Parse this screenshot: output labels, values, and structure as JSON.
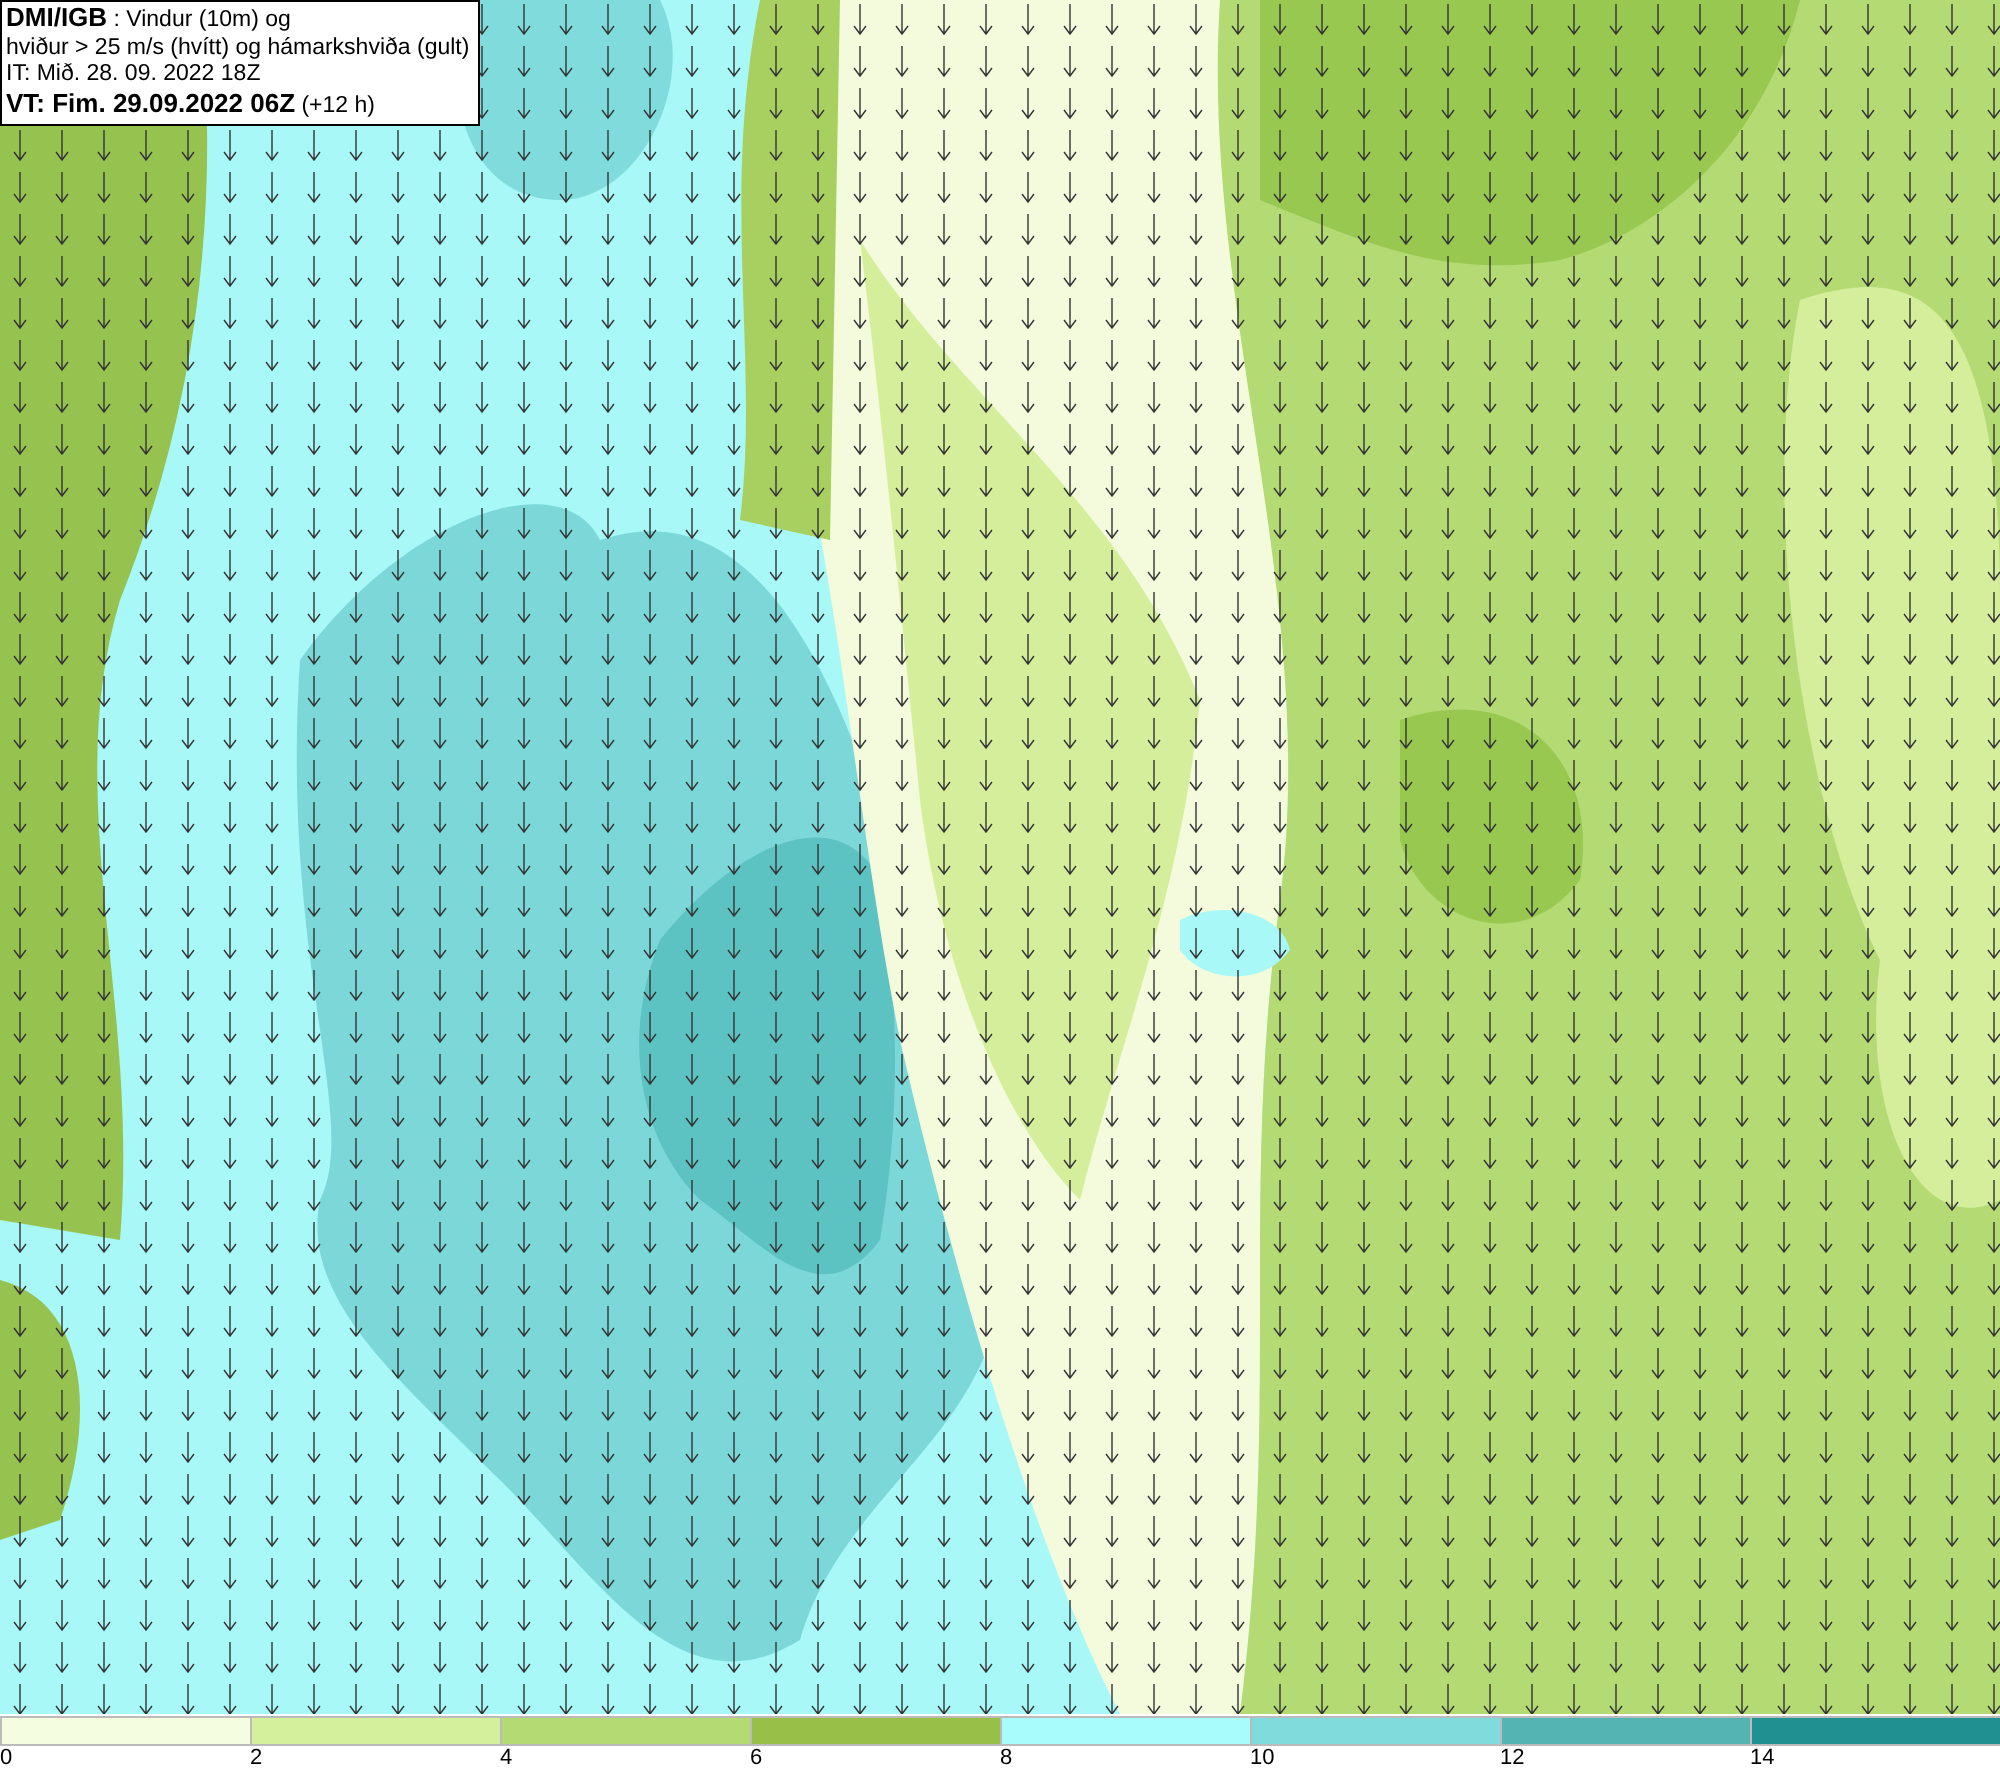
{
  "info_box": {
    "lines": [
      "**DMI/IGB** : Vindur (10m) og",
      "hviður > 25 m/s (hvítt) og hámarkshviða (gult)",
      "IT: Mið. 28. 09. 2022 18Z",
      "**VT: Fim. 29.09.2022 06Z** (+12 h)"
    ]
  },
  "legend": [
    {
      "label": "0",
      "color": "#f5fde0"
    },
    {
      "label": "2",
      "color": "#d4f09c"
    },
    {
      "label": "4",
      "color": "#b4da74"
    },
    {
      "label": "6",
      "color": "#98c048"
    },
    {
      "label": "8",
      "color": "#a8fcfc"
    },
    {
      "label": "10",
      "color": "#80dcdc"
    },
    {
      "label": "12",
      "color": "#54b4b4"
    },
    {
      "label": "14",
      "color": "#209090"
    }
  ]
}
